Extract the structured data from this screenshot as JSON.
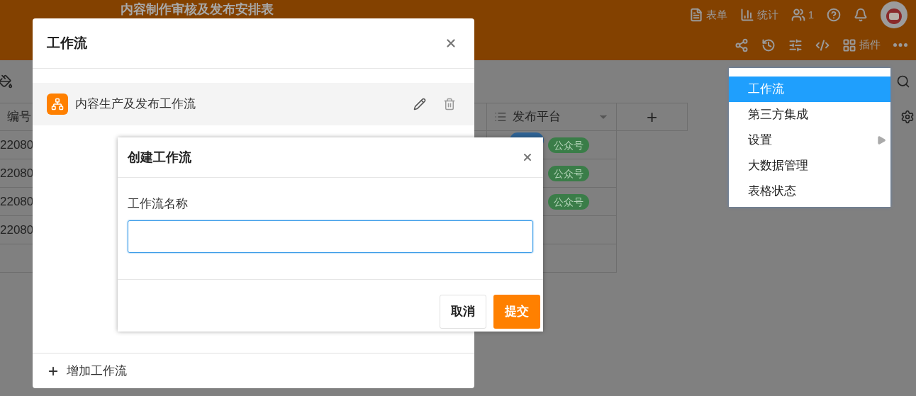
{
  "header": {
    "title": "内容制作审核及发布安排表",
    "actions": [
      {
        "kind": "form",
        "label": "表单"
      },
      {
        "kind": "stats",
        "label": "统计"
      },
      {
        "kind": "users",
        "label": "1"
      },
      {
        "kind": "help"
      },
      {
        "kind": "bell"
      },
      {
        "kind": "avatar"
      }
    ],
    "tools": [
      {
        "kind": "share"
      },
      {
        "kind": "history"
      },
      {
        "kind": "sliders"
      },
      {
        "kind": "code"
      },
      {
        "kind": "plugins",
        "label": "插件"
      },
      {
        "kind": "more"
      }
    ]
  },
  "table": {
    "columns": [
      {
        "kind": "text",
        "label": "编号"
      },
      {
        "kind": "select",
        "label": "发布平台"
      },
      {
        "kind": "add",
        "label": "+"
      }
    ],
    "rows": [
      {
        "id": "22080",
        "tags": [
          {
            "color": "#2f6496"
          },
          {
            "text": "公众号",
            "color": "#3a7d48"
          }
        ]
      },
      {
        "id": "22080",
        "tags": [
          {
            "text": "公众号",
            "color": "#3a7d48"
          }
        ]
      },
      {
        "id": "22080",
        "tags": [
          {
            "text": "公众号",
            "color": "#3a7d48"
          }
        ]
      },
      {
        "id": "22080",
        "tags": []
      }
    ]
  },
  "menu": {
    "items": [
      {
        "label": "工作流",
        "selected": true,
        "submenu": false
      },
      {
        "label": "第三方集成",
        "selected": false,
        "submenu": false
      },
      {
        "label": "设置",
        "selected": false,
        "submenu": true
      },
      {
        "label": "大数据管理",
        "selected": false,
        "submenu": false
      },
      {
        "label": "表格状态",
        "selected": false,
        "submenu": false
      }
    ]
  },
  "workflow_dialog": {
    "title": "工作流",
    "items": [
      {
        "name": "内容生产及发布工作流"
      }
    ],
    "add_label": "增加工作流"
  },
  "create_dialog": {
    "title": "创建工作流",
    "field_label": "工作流名称",
    "buttons": [
      {
        "kind": "secondary",
        "label": "取消"
      },
      {
        "kind": "primary",
        "label": "提交"
      }
    ]
  }
}
